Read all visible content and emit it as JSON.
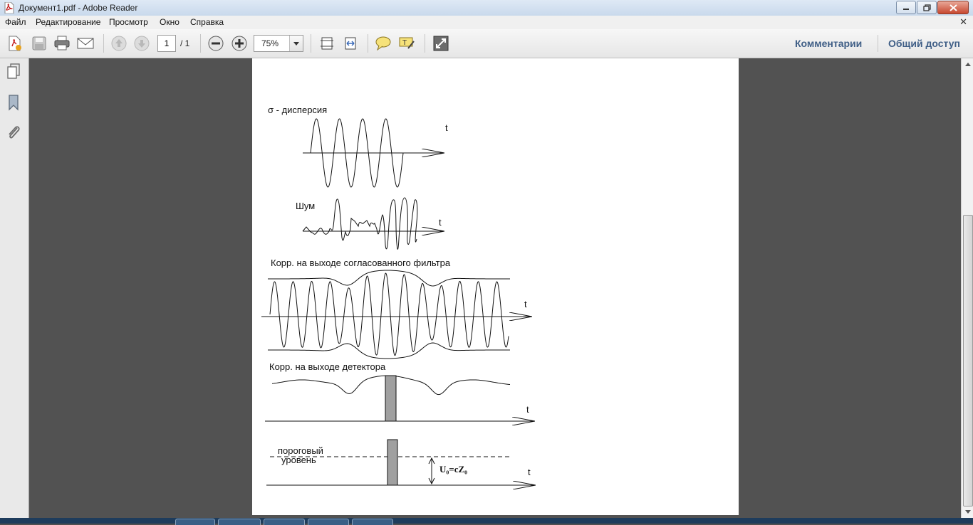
{
  "window": {
    "title": "Документ1.pdf - Adobe Reader"
  },
  "menu": {
    "items": [
      "Файл",
      "Редактирование",
      "Просмотр",
      "Окно",
      "Справка"
    ]
  },
  "toolbar": {
    "page_current": "1",
    "page_total": "/ 1",
    "zoom": "75%",
    "comments_label": "Комментарии",
    "share_label": "Общий доступ"
  },
  "figure": {
    "label_dispersion": "σ - дисперсия",
    "label_noise": "Шум",
    "label_corr_filter": "Корр. на выходе согласованного фильтра",
    "label_corr_detector": "Корр. на выходе детектора",
    "label_threshold_1": "пороговый",
    "label_threshold_2": "уровень",
    "label_formula": "U₀=cZ₀",
    "axis_t": "t"
  }
}
